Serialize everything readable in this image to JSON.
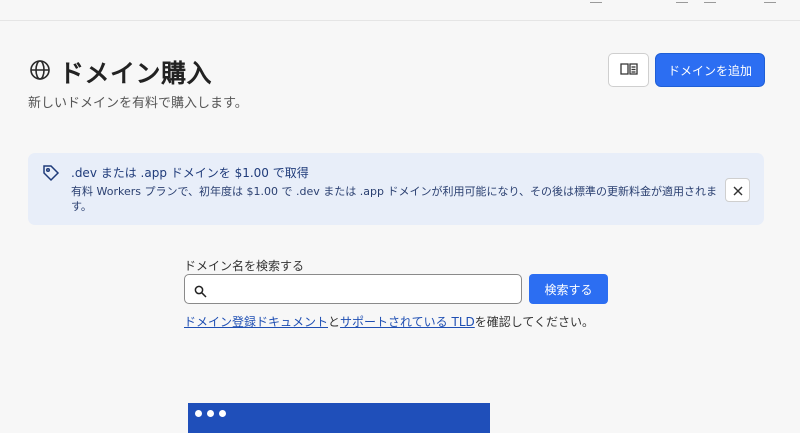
{
  "header": {
    "title": "ドメイン購入",
    "subtitle": "新しいドメインを有料で購入します。",
    "add_button": "ドメインを追加",
    "icons": {
      "title": "globe-icon",
      "docs": "book-icon"
    }
  },
  "banner": {
    "title": ".dev または .app ドメインを $1.00 で取得",
    "body": "有料 Workers プランで、初年度は $1.00 で .dev または .app ドメインが利用可能になり、その後は標準の更新料金が適用されます。",
    "icons": {
      "tag": "tag-icon",
      "close": "close-icon"
    }
  },
  "search": {
    "label": "ドメイン名を検索する",
    "value": "",
    "placeholder": "",
    "button": "検索する",
    "icon": "search-icon"
  },
  "help": {
    "link1": "ドメイン登録ドキュメント",
    "between": "と",
    "link2": "サポートされている TLD",
    "suffix": "を確認してください。"
  },
  "colors": {
    "primary": "#2c6ef2",
    "banner_bg": "#e8eef9",
    "illustration": "#1f4fba"
  }
}
